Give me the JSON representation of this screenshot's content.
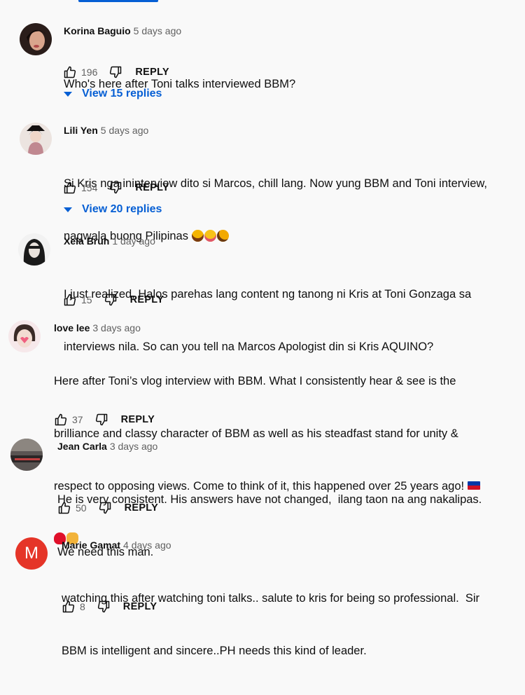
{
  "comments": [
    {
      "author": "Korina Baguio",
      "time": "5 days ago",
      "lines": [
        "Who's here after Toni talks interviewed BBM?"
      ],
      "likes": "196",
      "reply_label": "REPLY",
      "view_replies": "View 15 replies",
      "avatar_icon": "profile-photo-icon"
    },
    {
      "author": "Lili Yen",
      "time": "5 days ago",
      "lines": [
        "Si Kris nga ininterview dito si Marcos, chill lang. Now yung BBM and Toni interview,",
        "nagwala buong Pilipinas"
      ],
      "emojis": [
        "grinning-sweat-emoji",
        "winking-tongue-emoji",
        "rolling-laughing-emoji"
      ],
      "likes": "154",
      "reply_label": "REPLY",
      "view_replies": "View 20 replies",
      "avatar_icon": "profile-photo-icon"
    },
    {
      "author": "Xela Bruh",
      "time": "1 day ago",
      "lines": [
        "I just realized, Halos parehas lang content ng tanong ni Kris at Toni Gonzaga sa",
        "interviews nila. So can you tell na Marcos Apologist din si Kris AQUINO?"
      ],
      "likes": "15",
      "reply_label": "REPLY",
      "avatar_icon": "profile-photo-icon"
    },
    {
      "author": "love lee",
      "time": "3 days ago",
      "lines": [
        "Here after Toni’s vlog interview with BBM. What I consistently hear & see is the",
        "brilliance and classy character of BBM as well as his steadfast stand for unity &",
        "respect to opposing views. Come to think of it, this happened over 25 years ago!"
      ],
      "emojis": [
        "philippines-flag-emoji",
        "red-heart-emoji",
        "victory-hand-emoji"
      ],
      "likes": "37",
      "reply_label": "REPLY",
      "avatar_icon": "profile-photo-icon"
    },
    {
      "author": "Jean Carla",
      "time": "3 days ago",
      "lines": [
        "He is very consistent. His answers have not changed,  ilang taon na ang nakalipas.",
        "We need this man."
      ],
      "likes": "50",
      "reply_label": "REPLY",
      "avatar_icon": "profile-photo-icon"
    },
    {
      "author": "Marie Gamat",
      "time": "4 days ago",
      "avatar_letter": "M",
      "lines": [
        "watching this after watching toni talks.. salute to kris for being so professional.  Sir",
        "BBM is intelligent and sincere..PH needs this kind of leader."
      ],
      "likes": "8",
      "reply_label": "REPLY"
    }
  ],
  "colors": {
    "background": "#f9f9f9",
    "link_blue": "#065fd4",
    "secondary_text": "#606060",
    "letter_avatar_red": "#e53528"
  }
}
